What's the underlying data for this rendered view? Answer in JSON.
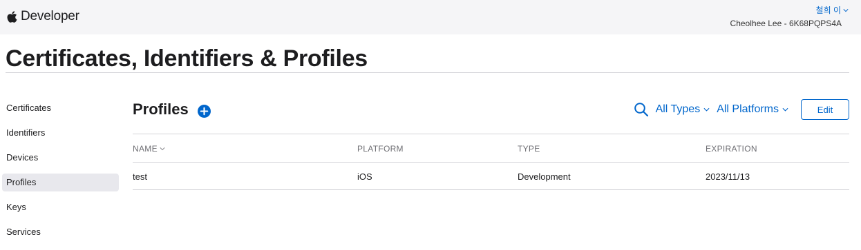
{
  "header": {
    "brand": "Developer",
    "user_name": "철희 이",
    "team": "Cheolhee Lee - 6K68PQPS4A"
  },
  "page_title": "Certificates, Identifiers & Profiles",
  "sidebar": {
    "items": [
      {
        "label": "Certificates",
        "active": false
      },
      {
        "label": "Identifiers",
        "active": false
      },
      {
        "label": "Devices",
        "active": false
      },
      {
        "label": "Profiles",
        "active": true
      },
      {
        "label": "Keys",
        "active": false
      },
      {
        "label": "Services",
        "active": false
      }
    ]
  },
  "main": {
    "section_title": "Profiles",
    "filters": {
      "type": "All Types",
      "platform": "All Platforms"
    },
    "edit_label": "Edit"
  },
  "table": {
    "columns": [
      "NAME",
      "PLATFORM",
      "TYPE",
      "EXPIRATION"
    ],
    "rows": [
      {
        "name": "test",
        "platform": "iOS",
        "type": "Development",
        "expiration": "2023/11/13"
      }
    ]
  },
  "colors": {
    "accent": "#0066cc",
    "topbar_bg": "#f5f5f7",
    "active_item_bg": "#e8e8ed",
    "divider": "#d2d2d7"
  },
  "icons": [
    "apple-logo-icon",
    "chevron-down-icon",
    "plus-circle-icon",
    "search-icon"
  ]
}
